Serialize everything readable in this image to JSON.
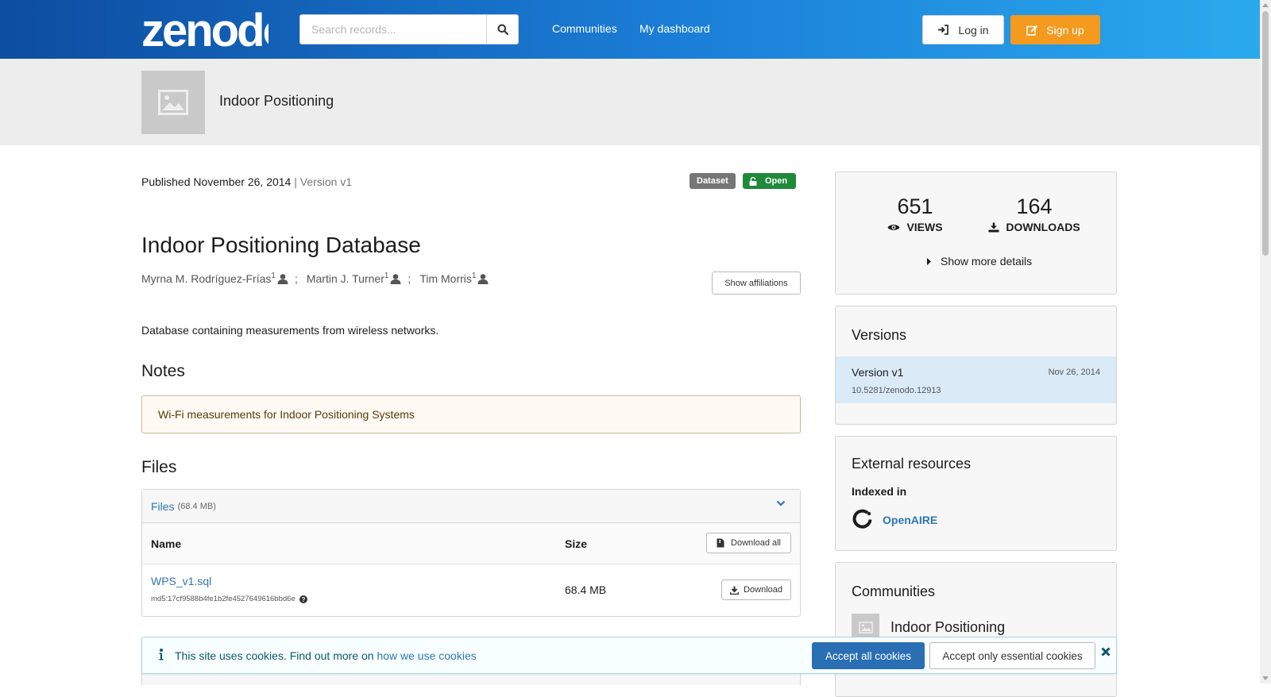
{
  "header": {
    "logo_text": "zenodo",
    "search_placeholder": "Search records...",
    "nav": {
      "communities": "Communities",
      "dashboard": "My dashboard"
    },
    "login_label": "Log in",
    "signup_label": "Sign up",
    "colors": {
      "gradient_start": "#0d4da1",
      "gradient_end": "#2aa9ee",
      "signup": "#f39a1f"
    }
  },
  "community_strip": {
    "title": "Indoor Positioning"
  },
  "record": {
    "published": "Published November 26, 2014",
    "version_sep": " | ",
    "version": "Version v1",
    "badge_type": "Dataset",
    "badge_access": "Open",
    "title": "Indoor Positioning Database",
    "creators": [
      {
        "name": "Myrna M. Rodríguez-Frías",
        "aff": "1"
      },
      {
        "name": "Martin J. Turner",
        "aff": "1"
      },
      {
        "name": "Tim Morris",
        "aff": "1"
      }
    ],
    "creator_sep": ";",
    "show_affiliations": "Show affiliations",
    "description": "Database containing measurements from wireless networks.",
    "notes_heading": "Notes",
    "notes_text": "Wi-Fi measurements for Indoor Positioning Systems"
  },
  "files": {
    "heading": "Files",
    "panel_label": "Files",
    "panel_size": "(68.4 MB)",
    "col_name": "Name",
    "col_size": "Size",
    "download_all": "Download all",
    "rows": [
      {
        "name": "WPS_v1.sql",
        "md5": "md5:17cf9588b4fe1b2fe4527649616bbd6e",
        "size": "68.4 MB",
        "download": "Download"
      }
    ]
  },
  "sidebar": {
    "stats": {
      "views": "651",
      "views_label": "VIEWS",
      "downloads": "164",
      "downloads_label": "DOWNLOADS",
      "more": "Show more details"
    },
    "versions": {
      "title": "Versions",
      "items": [
        {
          "label": "Version v1",
          "date": "Nov 26, 2014",
          "doi": "10.5281/zenodo.12913"
        }
      ]
    },
    "external": {
      "title": "External resources",
      "indexed": "Indexed in",
      "openaire": "OpenAIRE"
    },
    "communities": {
      "title": "Communities",
      "items": [
        {
          "name": "Indoor Positioning"
        }
      ]
    }
  },
  "cookie": {
    "text": "This site uses cookies. Find out more on ",
    "link": "how we use cookies",
    "accept_all": "Accept all cookies",
    "accept_essential": "Accept only essential cookies"
  }
}
